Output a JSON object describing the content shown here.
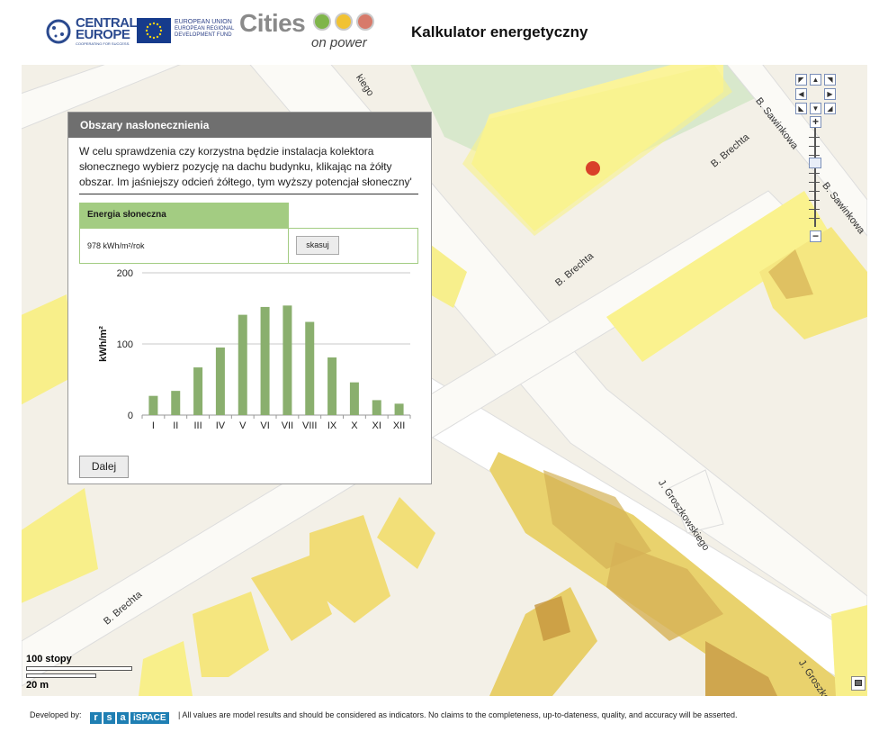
{
  "header": {
    "central_europe_line1": "CENTRAL",
    "central_europe_line2": "EUROPE",
    "central_europe_tagline": "COOPERATING FOR SUCCESS.",
    "eu_line1": "EUROPEAN UNION",
    "eu_line2": "EUROPEAN REGIONAL",
    "eu_line3": "DEVELOPMENT FUND",
    "cities_word": "Cities",
    "cities_sub": "on power",
    "app_title": "Kalkulator energetyczny"
  },
  "map": {
    "streets": {
      "s1": "B. Sawinkowa",
      "s2": "B. Sawinkowa",
      "s3": "B. Brechta",
      "s4": "B. Brechta",
      "s5": "J. Groszkowskiego",
      "s6": "B. Brechta",
      "s7": "J. Groszko",
      "s8": "kiego"
    },
    "scale_top": "100 stopy",
    "scale_bottom": "20 m",
    "marker_color": "#d9402a"
  },
  "panel": {
    "title": "Obszary nasłonecznienia",
    "description": "W celu sprawdzenia czy korzystna będzie instalacja kolektora słonecznego wybierz pozycję na dachu budynku, klikając na żółty obszar. Im jaśniejszy odcień żółtego, tym wyższy potencjał słoneczny'",
    "energy_header": "Energia słoneczna",
    "energy_value": "978 kWh/m²/rok",
    "cancel_label": "skasuj",
    "next_label": "Dalej"
  },
  "chart_data": {
    "type": "bar",
    "categories": [
      "I",
      "II",
      "III",
      "IV",
      "V",
      "VI",
      "VII",
      "VIII",
      "IX",
      "X",
      "XI",
      "XII"
    ],
    "values": [
      27,
      34,
      67,
      95,
      141,
      152,
      154,
      131,
      81,
      46,
      21,
      16
    ],
    "ylabel": "kWh/m²",
    "ylim": [
      0,
      200
    ],
    "yticks": [
      0,
      100,
      200
    ],
    "grid": true,
    "bar_color": "#8aaf6e"
  },
  "footer": {
    "developed_by": "Developed by:",
    "rsa_letters": [
      "r",
      "s",
      "a"
    ],
    "rsa_space": "iSPACE",
    "disclaimer": "| All values are model results and should be considered as indicators. No claims to the completeness, up-to-dateness, quality, and accuracy will be asserted."
  }
}
